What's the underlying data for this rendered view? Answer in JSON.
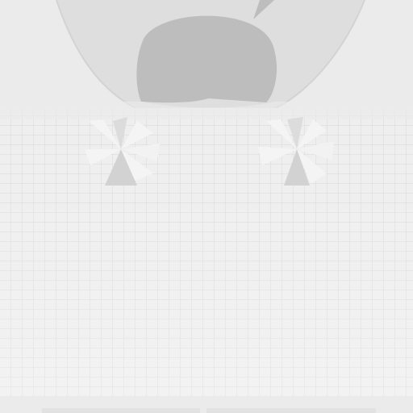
{
  "texture": {
    "kind": "clothing-texture-template",
    "palette": {
      "background": "#ebebeb",
      "collar_fill": "#dedede",
      "neck_fill": "#bdbdbd",
      "grid_base": "#eeeeee",
      "grid_line": "#d7d7d7",
      "fold_light": "#f4f4f4",
      "fold_shadow": "#d2d2d2",
      "hem_band": "#e2e2e2"
    }
  }
}
